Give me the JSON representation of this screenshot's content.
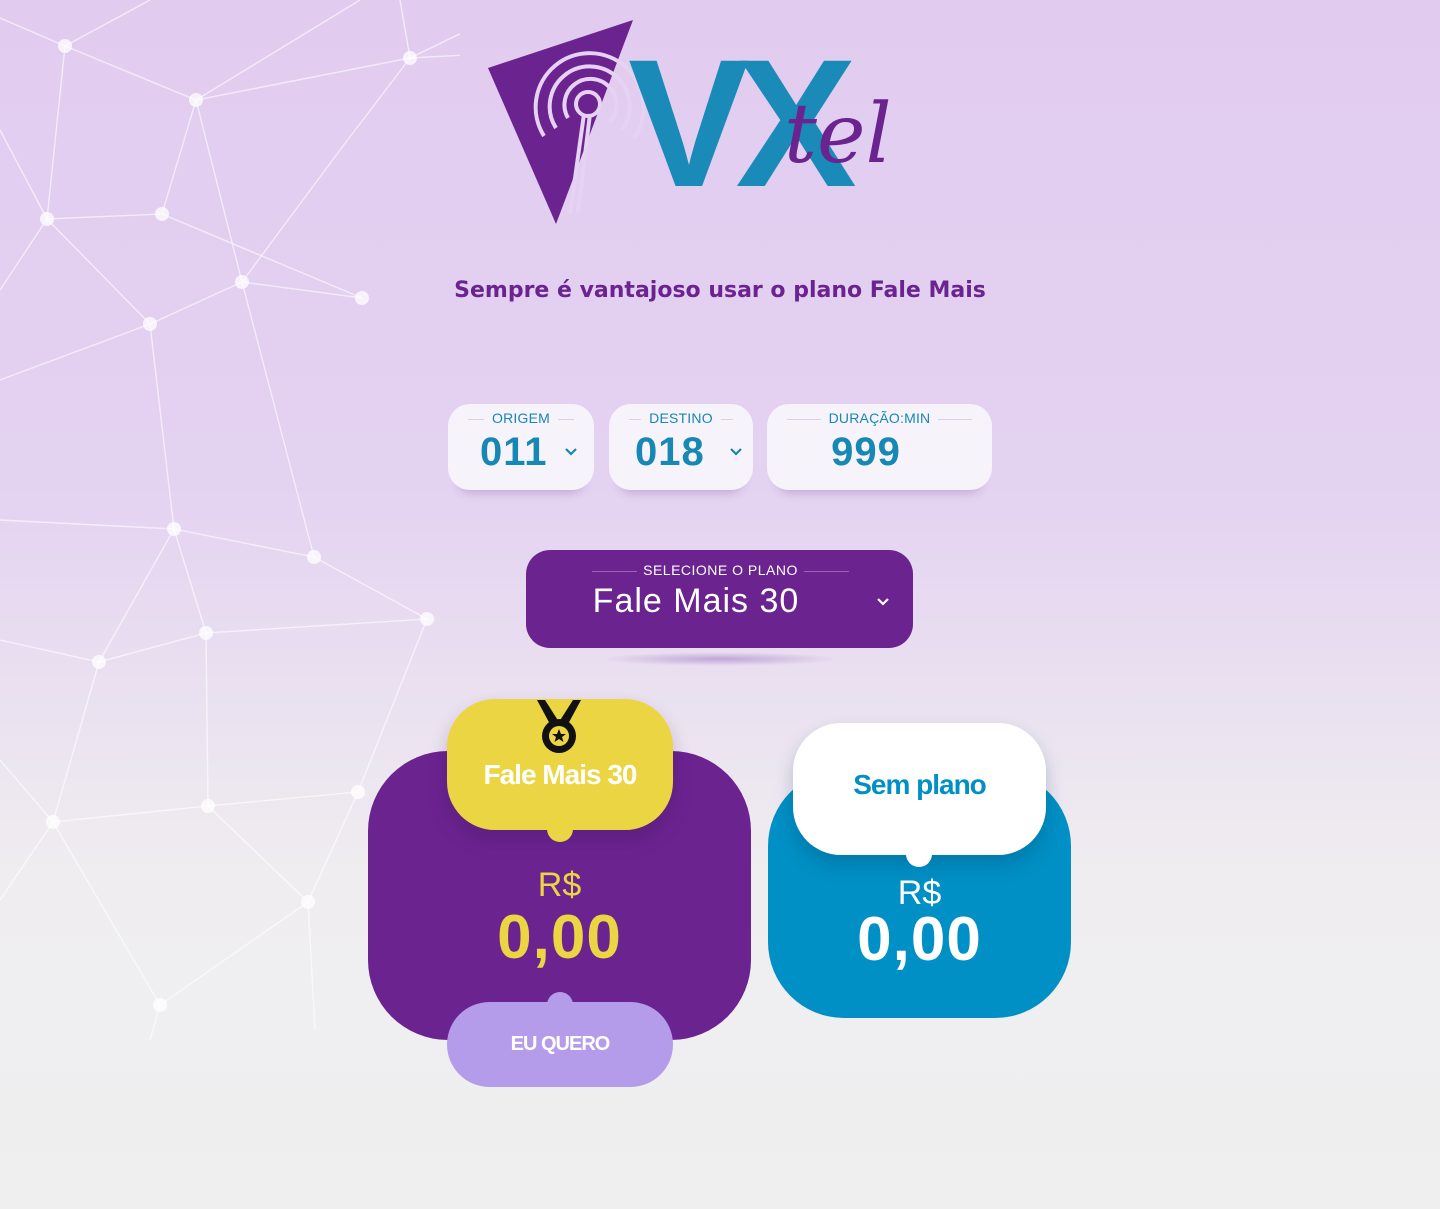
{
  "brand": {
    "logo_text_primary": "VX",
    "logo_text_script": "tel"
  },
  "tagline": "Sempre é vantajoso usar o plano Fale Mais",
  "form": {
    "origin": {
      "label": "ORIGEM",
      "value": "011"
    },
    "destination": {
      "label": "DESTINO",
      "value": "018"
    },
    "duration": {
      "label": "DURAÇÃO:MIN",
      "value": "999"
    },
    "plan": {
      "label": "SELECIONE O PLANO",
      "value": "Fale Mais 30"
    }
  },
  "results": {
    "with_plan": {
      "title": "Fale Mais 30",
      "currency": "R$",
      "amount": "0,00",
      "cta": "EU QUERO",
      "icon": "medal-icon"
    },
    "without_plan": {
      "title": "Sem plano",
      "currency": "R$",
      "amount": "0,00"
    }
  },
  "colors": {
    "purple": "#6b2390",
    "blue": "#0190c5",
    "yellow": "#ebd542",
    "lilac": "#b59ceb",
    "text_blue": "#1787b4"
  }
}
